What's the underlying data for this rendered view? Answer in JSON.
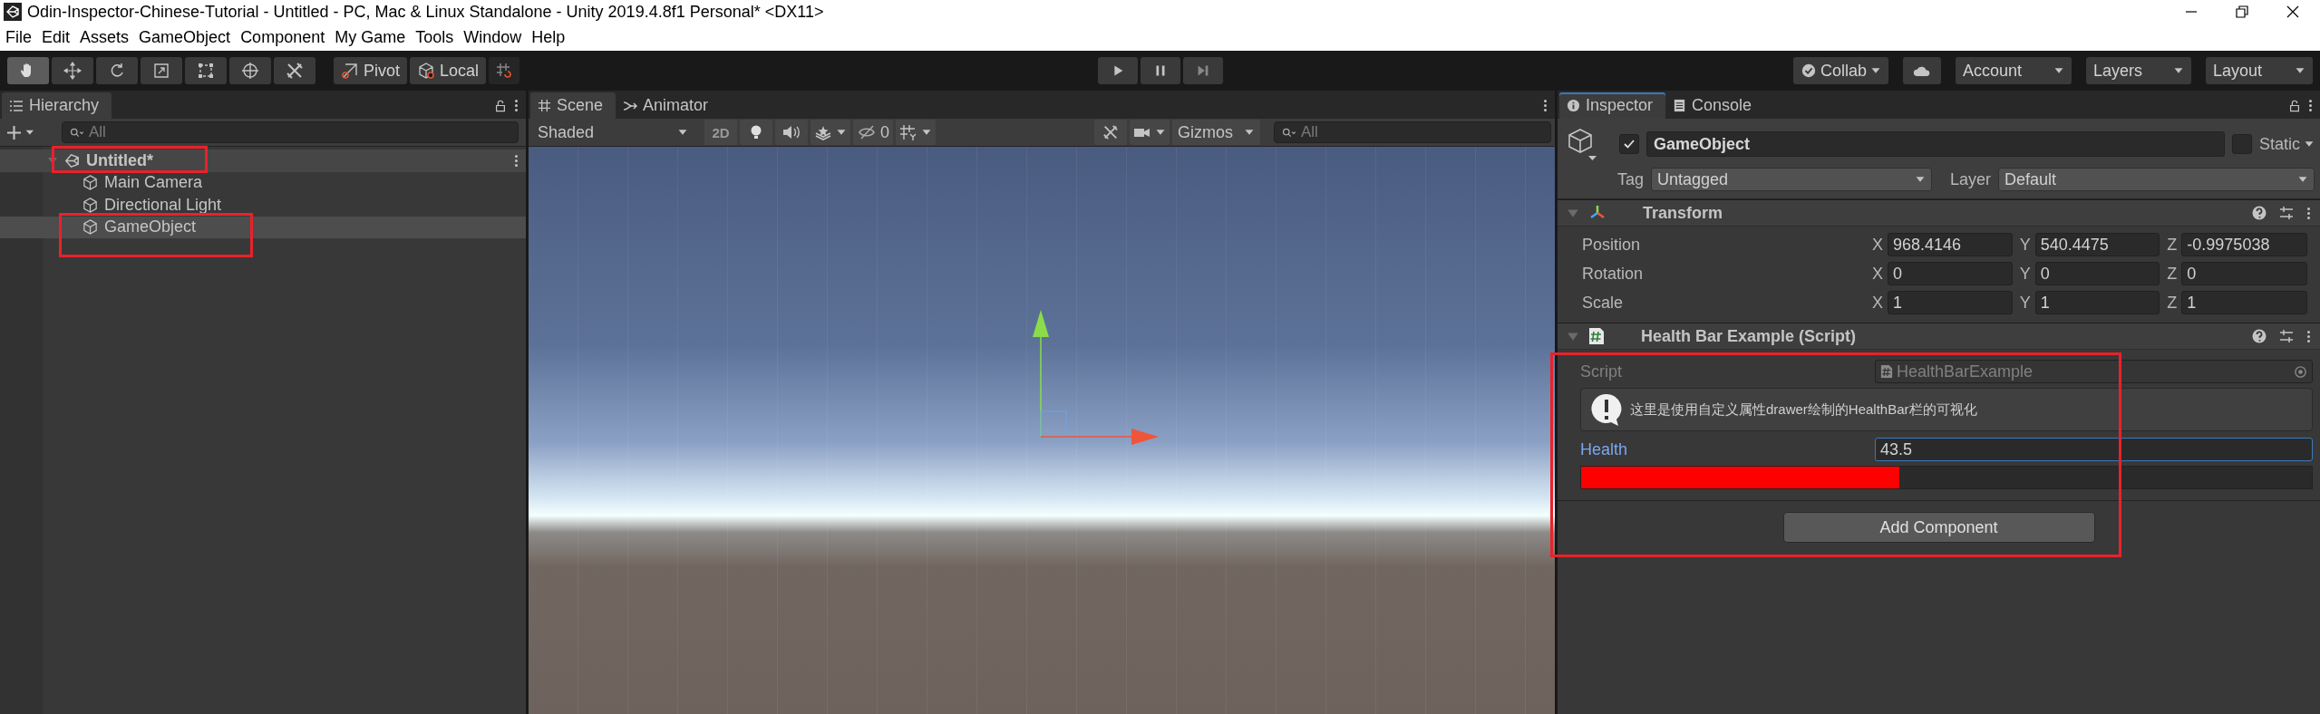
{
  "window": {
    "title": "Odin-Inspector-Chinese-Tutorial - Untitled - PC, Mac & Linux Standalone - Unity 2019.4.8f1 Personal* <DX11>"
  },
  "menu": [
    "File",
    "Edit",
    "Assets",
    "GameObject",
    "Component",
    "My Game",
    "Tools",
    "Window",
    "Help"
  ],
  "toolbar": {
    "tools": [
      {
        "kind": "hand",
        "selected": true
      },
      {
        "kind": "move",
        "selected": false
      },
      {
        "kind": "rotate",
        "selected": false
      },
      {
        "kind": "scale",
        "selected": false
      },
      {
        "kind": "rect",
        "selected": false
      },
      {
        "kind": "transform",
        "selected": false
      },
      {
        "kind": "custom",
        "selected": false
      }
    ],
    "pivot": "Pivot",
    "local": "Local",
    "collab": "Collab",
    "account": "Account",
    "layers": "Layers",
    "layout": "Layout"
  },
  "hierarchy": {
    "tab": "Hierarchy",
    "search_placeholder": "All",
    "scene": {
      "name": "Untitled*",
      "expanded": true,
      "highlighted": true,
      "children": [
        {
          "name": "Main Camera",
          "selected": false,
          "highlighted": false
        },
        {
          "name": "Directional Light",
          "selected": false,
          "highlighted": false
        },
        {
          "name": "GameObject",
          "selected": true,
          "highlighted": true
        }
      ]
    }
  },
  "scene_view": {
    "tabs": [
      {
        "label": "Scene",
        "kind": "scene",
        "selected": true
      },
      {
        "label": "Animator",
        "kind": "animator",
        "selected": false
      }
    ],
    "shading": "Shaded",
    "mode_2d": "2D",
    "hidden_count": "0",
    "gizmos": "Gizmos",
    "search_placeholder": "All"
  },
  "inspector": {
    "tabs": [
      {
        "label": "Inspector",
        "kind": "info",
        "selected": true
      },
      {
        "label": "Console",
        "kind": "console",
        "selected": false
      }
    ],
    "object": {
      "name": "GameObject",
      "active": true,
      "static": false,
      "static_label": "Static",
      "tag_label": "Tag",
      "tag": "Untagged",
      "layer_label": "Layer",
      "layer": "Default"
    },
    "transform": {
      "title": "Transform",
      "expanded": true,
      "rows": [
        {
          "label": "Position",
          "fields": [
            {
              "axis": "X",
              "value": "968.4146"
            },
            {
              "axis": "Y",
              "value": "540.4475"
            },
            {
              "axis": "Z",
              "value": "-0.9975038"
            }
          ]
        },
        {
          "label": "Rotation",
          "fields": [
            {
              "axis": "X",
              "value": "0"
            },
            {
              "axis": "Y",
              "value": "0"
            },
            {
              "axis": "Z",
              "value": "0"
            }
          ]
        },
        {
          "label": "Scale",
          "fields": [
            {
              "axis": "X",
              "value": "1"
            },
            {
              "axis": "Y",
              "value": "1"
            },
            {
              "axis": "Z",
              "value": "1"
            }
          ]
        }
      ]
    },
    "health_component": {
      "title": "Health Bar Example (Script)",
      "expanded": true,
      "highlighted": true,
      "script_label": "Script",
      "script_value": "HealthBarExample",
      "help": "这里是使用自定义属性drawer绘制的HealthBar栏的可视化",
      "health_label": "Health",
      "health_value": "43.5",
      "level": 0.435
    },
    "add_component": "Add Component"
  }
}
